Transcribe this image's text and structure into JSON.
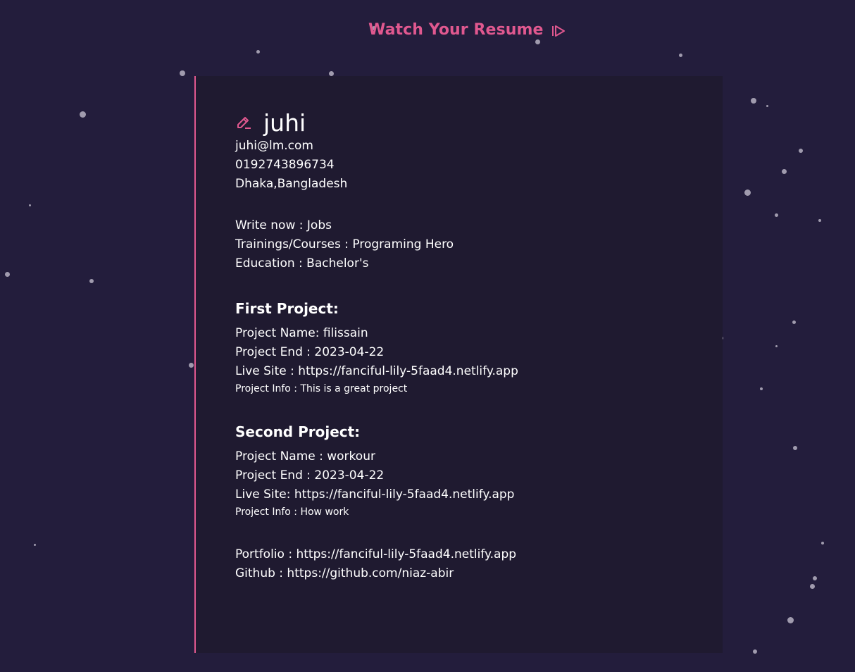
{
  "header": {
    "watch_label": "Watch Your Resume",
    "accent_color": "#e0588f",
    "icon": "play-step-forward-icon"
  },
  "profile": {
    "edit_icon": "edit-pencil-icon",
    "name": "juhi",
    "email": "juhi@lm.com",
    "phone": "0192743896734",
    "address": "Dhaka,Bangladesh"
  },
  "details": {
    "write_now": "Write now : Jobs",
    "trainings": "Trainings/Courses : Programing Hero",
    "education": "Education : Bachelor's"
  },
  "projects": [
    {
      "heading": "First Project:",
      "name": "Project Name: filissain",
      "end": "Project End : 2023-04-22",
      "live": "Live Site : https://fanciful-lily-5faad4.netlify.app",
      "info": "Project Info : This is a great project"
    },
    {
      "heading": "Second Project:",
      "name": "Project Name : workour",
      "end": "Project End : 2023-04-22",
      "live": "Live Site: https://fanciful-lily-5faad4.netlify.app",
      "info": "Project Info : How work"
    }
  ],
  "links": {
    "portfolio": "Portfolio : https://fanciful-lily-5faad4.netlify.app",
    "github": "Github : https://github.com/niaz-abir"
  },
  "colors": {
    "background": "#231d3c",
    "card": "#1f1a30",
    "text": "#ffffff",
    "star": "#b6b2c2"
  }
}
